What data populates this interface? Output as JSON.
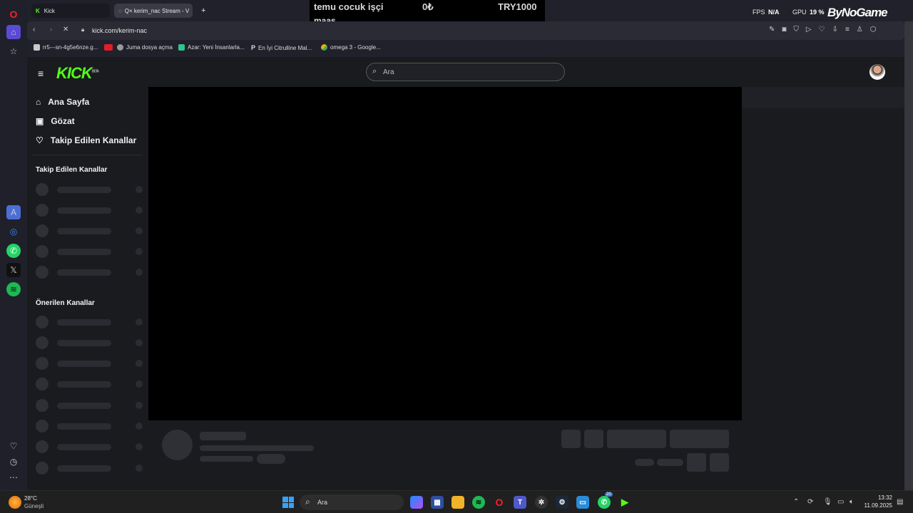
{
  "browser": {
    "tabs": [
      {
        "label": "Kick"
      },
      {
        "label": "Q× kerim_nac Stream - V"
      }
    ],
    "new_tab_label": "+",
    "url": "kick.com/kerim-nac",
    "bookmarks": [
      {
        "label": "rr5---sn-4g5e6nze.g..."
      },
      {
        "label": "Juma dosya açma"
      },
      {
        "label": "Azar: Yeni İnsanlarla..."
      },
      {
        "label": "En İyi Citrulline Mal..."
      },
      {
        "label": "omega 3 - Google..."
      }
    ]
  },
  "overlay": {
    "line1": "temu cocuk işçi",
    "line2": "maaş",
    "amount_left": "0₺",
    "amount_right": "TRY1000",
    "fps_label": "FPS",
    "fps_value": "N/A",
    "gpu_label": "GPU",
    "gpu_value": "19 %",
    "brand": "ByNoGame"
  },
  "kick": {
    "search_placeholder": "Ara",
    "nav": [
      {
        "label": "Ana Sayfa",
        "icon": "home-icon"
      },
      {
        "label": "Gözat",
        "icon": "browse-icon"
      },
      {
        "label": "Takip Edilen Kanallar",
        "icon": "heart-icon"
      }
    ],
    "followed_title": "Takip Edilen Kanallar",
    "recommended_title": "Önerilen Kanallar"
  },
  "taskbar": {
    "weather_temp": "28°C",
    "weather_desc": "Güneşli",
    "search_label": "Ara",
    "time": "13:32",
    "date": "11.09.2025",
    "badge_count": "20"
  },
  "colors": {
    "kick_green": "#53fc18",
    "page_bg": "#191b1f",
    "skeleton": "#2e3036"
  }
}
